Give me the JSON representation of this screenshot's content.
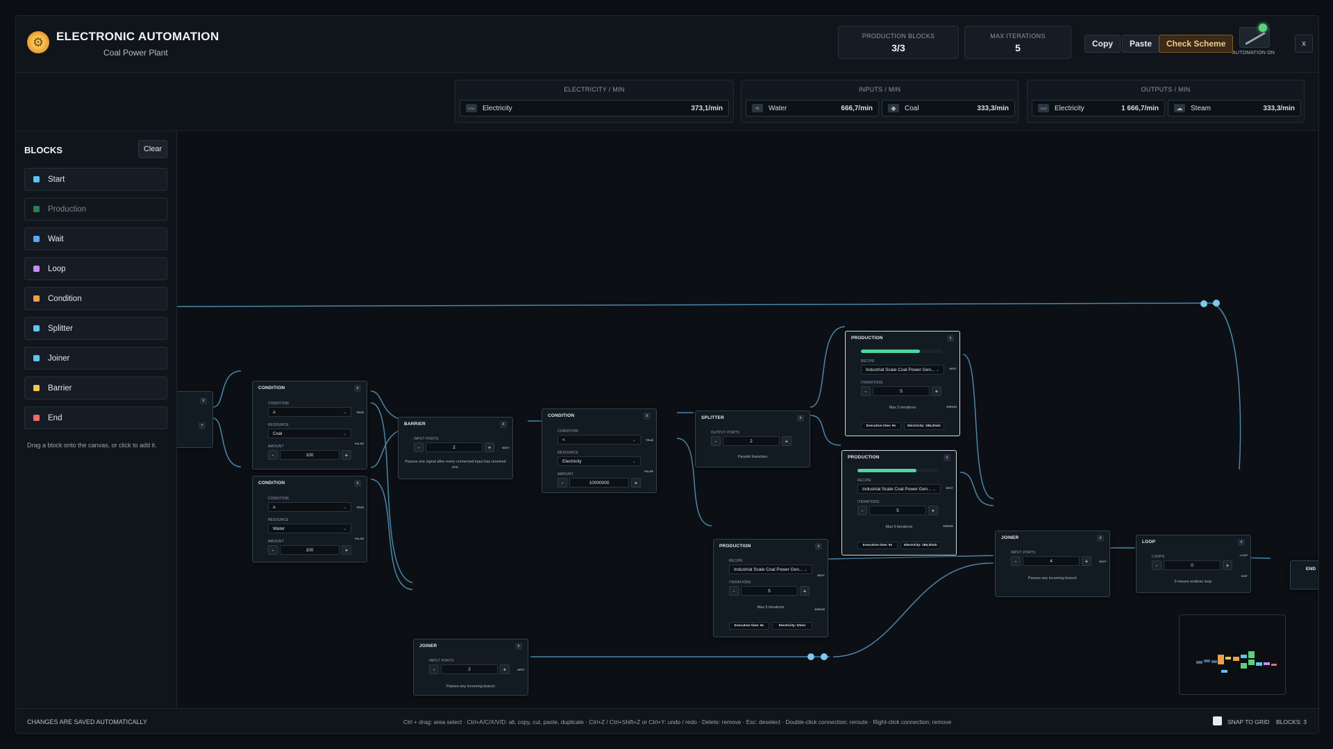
{
  "header": {
    "title": "ELECTRONIC AUTOMATION",
    "subtitle": "Coal Power Plant",
    "production_blocks_label": "PRODUCTION BLOCKS",
    "production_blocks_value": "3/3",
    "max_iterations_label": "MAX ITERATIONS",
    "max_iterations_value": "5",
    "copy_label": "Copy",
    "paste_label": "Paste",
    "check_label": "Check Scheme",
    "automation_label": "AUTOMATION ON",
    "close_label": "x",
    "accent_color": "#e89b2b"
  },
  "flows": {
    "electricity_title": "ELECTRICITY / MIN",
    "electricity": {
      "name": "Electricity",
      "rate": "373,1/min"
    },
    "inputs_title": "INPUTS / MIN",
    "inputs": [
      {
        "name": "Water",
        "rate": "666,7/min"
      },
      {
        "name": "Coal",
        "rate": "333,3/min"
      }
    ],
    "outputs_title": "OUTPUTS / MIN",
    "outputs": [
      {
        "name": "Electricity",
        "rate": "1 666,7/min"
      },
      {
        "name": "Steam",
        "rate": "333,3/min"
      }
    ]
  },
  "sidebar": {
    "title": "BLOCKS",
    "clear_label": "Clear",
    "items": [
      {
        "label": "Start",
        "color": "#5cc6f0"
      },
      {
        "label": "Production",
        "color": "#3aa86a"
      },
      {
        "label": "Wait",
        "color": "#5ea7f0"
      },
      {
        "label": "Loop",
        "color": "#c78ef0"
      },
      {
        "label": "Condition",
        "color": "#f0a04a"
      },
      {
        "label": "Splitter",
        "color": "#5cc6f0"
      },
      {
        "label": "Joiner",
        "color": "#5cc6f0"
      },
      {
        "label": "Barrier",
        "color": "#f0c84a"
      },
      {
        "label": "End",
        "color": "#f06a6a"
      }
    ],
    "hint": "Drag a block onto the canvas, or click to add it."
  },
  "nodes": {
    "start": {
      "close": "x",
      "plus": "+"
    },
    "cond1": {
      "title": "CONDITION",
      "close": "x",
      "condition_label": "CONDITION",
      "condition_value": "≥",
      "resource_label": "RESOURCE",
      "resource_value": "Coal",
      "amount_label": "AMOUNT",
      "amount_value": "100",
      "minus": "-",
      "plus": "+",
      "true_label": "TRUE",
      "false_label": "FALSE"
    },
    "cond2": {
      "title": "CONDITION",
      "close": "x",
      "condition_label": "CONDITION",
      "condition_value": "≥",
      "resource_label": "RESOURCE",
      "resource_value": "Water",
      "amount_label": "AMOUNT",
      "amount_value": "100",
      "minus": "-",
      "plus": "+",
      "true_label": "TRUE",
      "false_label": "FALSE"
    },
    "barrier": {
      "title": "BARRIER",
      "close": "x",
      "ports_label": "INPUT PORTS",
      "ports_value": "2",
      "minus": "-",
      "plus": "+",
      "next_label": "NEXT",
      "note": "Passes one signal after every connected input has received one."
    },
    "cond3": {
      "title": "CONDITION",
      "close": "x",
      "condition_label": "CONDITION",
      "condition_value": "<",
      "resource_label": "RESOURCE",
      "resource_value": "Electricity",
      "amount_label": "AMOUNT",
      "amount_value": "10000000",
      "minus": "-",
      "plus": "+",
      "true_label": "TRUE",
      "false_label": "FALSE"
    },
    "splitter": {
      "title": "SPLITTER",
      "close": "x",
      "ports_label": "OUTPUT PORTS",
      "ports_value": "2",
      "minus": "-",
      "plus": "+",
      "note": "Parallel branches"
    },
    "prod1": {
      "title": "PRODUCTION",
      "close": "x",
      "progress": 0.72,
      "recipe_label": "RECIPE",
      "recipe_value": "Industrial Scale Coal Power Gen...",
      "iter_label": "ITERATIONS",
      "iter_value": "5",
      "minus": "-",
      "plus": "+",
      "note": "Max 5 iterations",
      "next_label": "NEXT",
      "error_label": "ERROR",
      "exec": "Execution time: 9s",
      "elec": "Electricity: 186,3/min"
    },
    "prod2": {
      "title": "PRODUCTION",
      "close": "x",
      "progress": 0.72,
      "recipe_label": "RECIPE",
      "recipe_value": "Industrial Scale Coal Power Gen...",
      "iter_label": "ITERATIONS",
      "iter_value": "5",
      "minus": "-",
      "plus": "+",
      "note": "Max 5 iterations",
      "next_label": "NEXT",
      "error_label": "ERROR",
      "exec": "Execution time: 9s",
      "elec": "Electricity: 186,3/min"
    },
    "prod3": {
      "title": "PRODUCTION",
      "close": "x",
      "recipe_label": "RECIPE",
      "recipe_value": "Industrial Scale Coal Power Gen...",
      "iter_label": "ITERATIONS",
      "iter_value": "5",
      "minus": "-",
      "plus": "+",
      "note": "Max 5 iterations",
      "next_label": "NEXT",
      "error_label": "ERROR",
      "exec": "Execution time: 9s",
      "elec": "Electricity: 0/min"
    },
    "joiner1": {
      "title": "JOINER",
      "close": "x",
      "ports_label": "INPUT PORTS",
      "ports_value": "2",
      "minus": "-",
      "plus": "+",
      "next_label": "NEXT",
      "note": "Passes any incoming branch"
    },
    "joiner2": {
      "title": "JOINER",
      "close": "x",
      "ports_label": "INPUT PORTS",
      "ports_value": "4",
      "minus": "-",
      "plus": "+",
      "next_label": "NEXT",
      "note": "Passes any incoming branch"
    },
    "loop": {
      "title": "LOOP",
      "close": "x",
      "loops_label": "LOOPS",
      "loops_value": "0",
      "minus": "-",
      "plus": "+",
      "loop_label": "LOOP",
      "exit_label": "EXIT",
      "note": "0 means endless loop."
    },
    "end": {
      "title": "END"
    }
  },
  "footer": {
    "saved": "CHANGES ARE SAVED AUTOMATICALLY",
    "shortcuts": "Ctrl + drag: area select · Ctrl+A/C/X/V/D: all, copy, cut, paste, duplicate · Ctrl+Z / Ctrl+Shift+Z or Ctrl+Y: undo / redo · Delete: remove · Esc: deselect · Double-click connection: reroute · Right-click connection: remove",
    "snap_label": "SNAP TO GRID",
    "blocks_count": "BLOCKS: 3"
  }
}
